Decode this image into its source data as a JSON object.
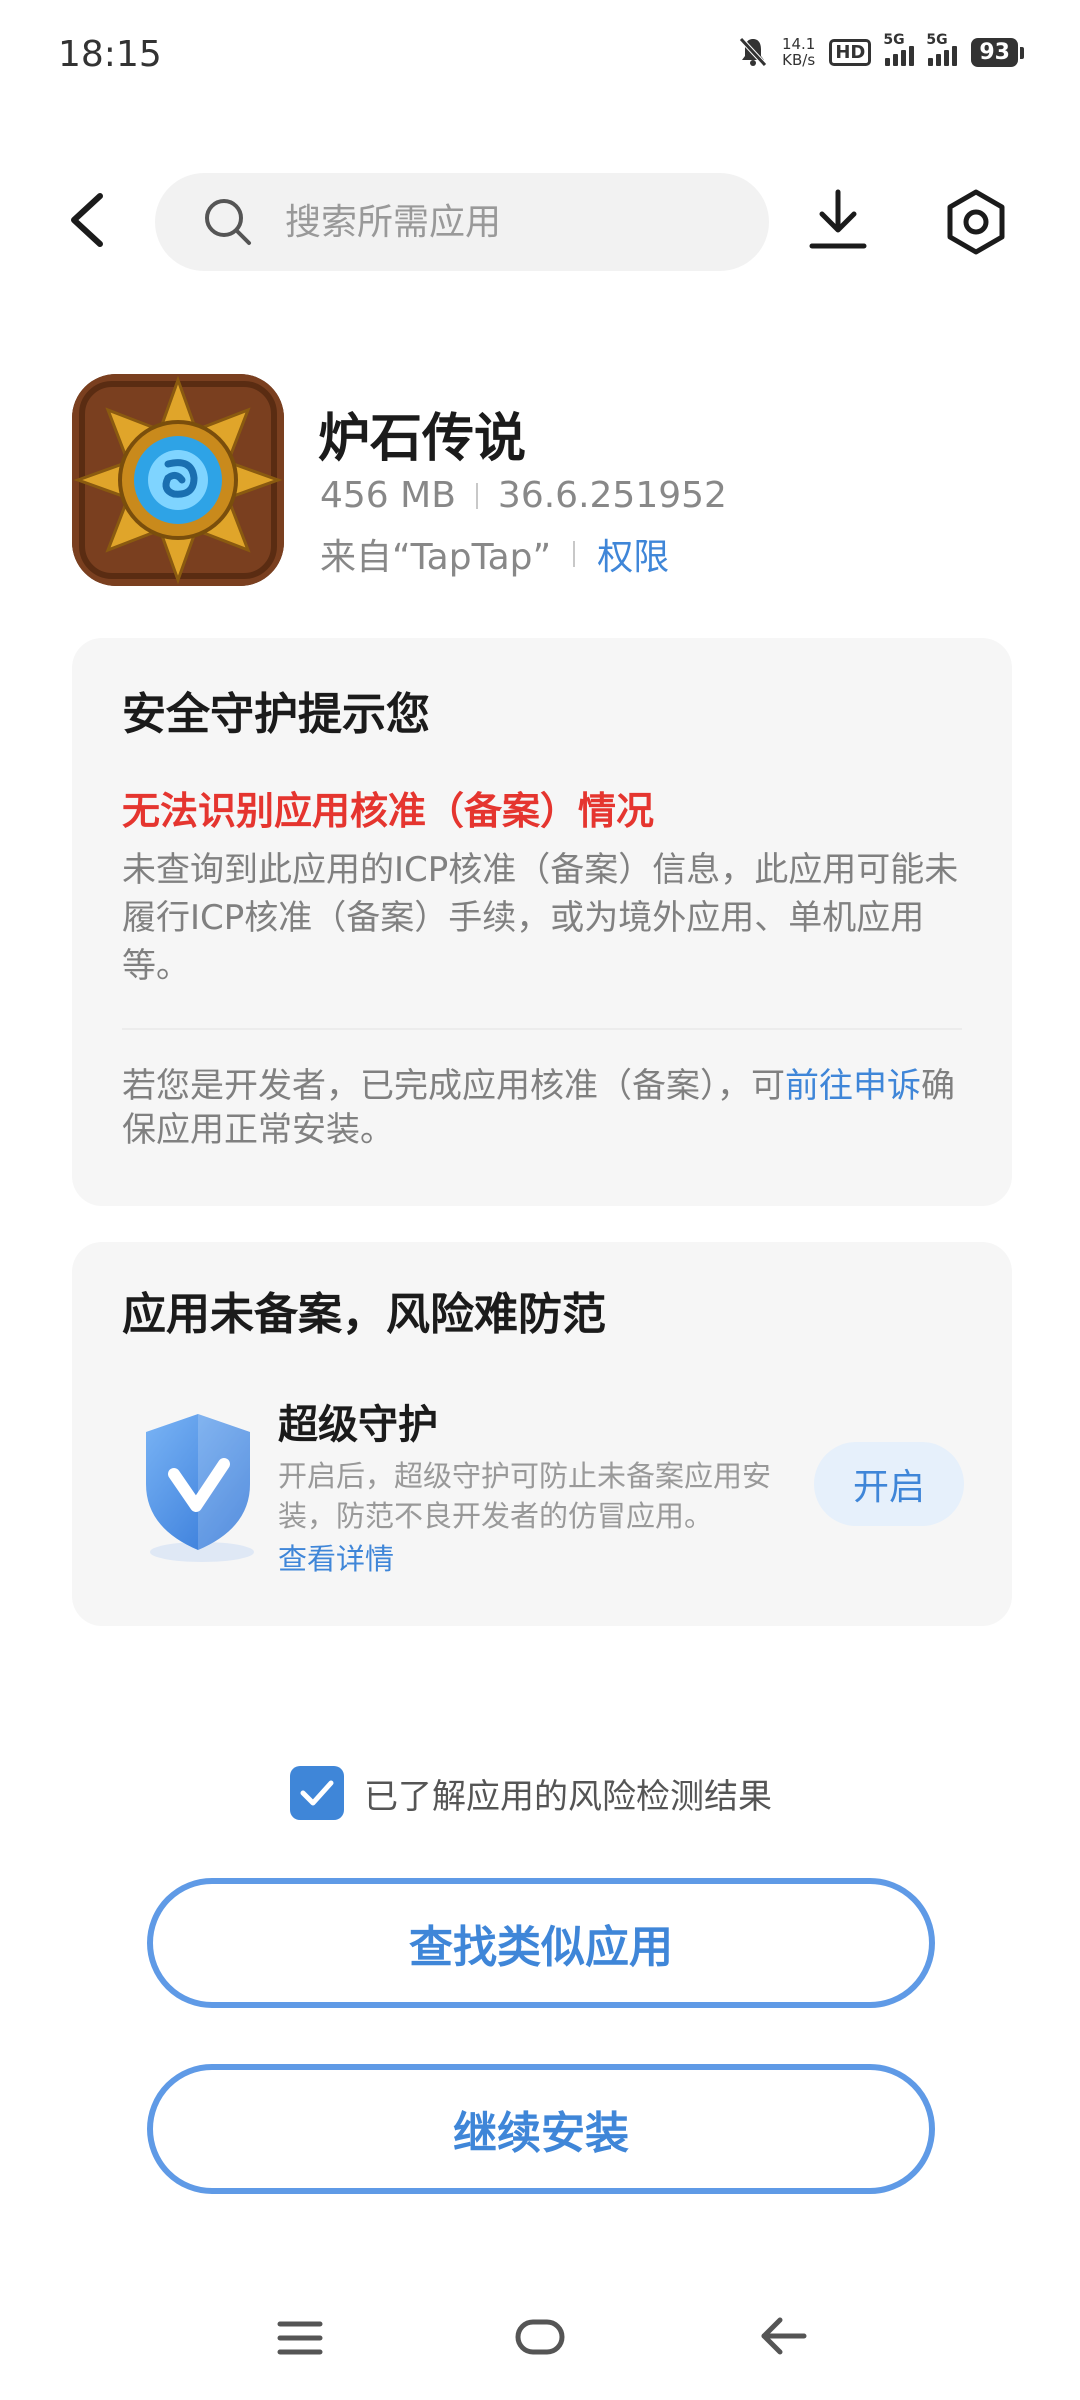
{
  "status_bar": {
    "time": "18:15",
    "net_speed_value": "14.1",
    "net_speed_unit": "KB/s",
    "hd_label": "HD",
    "signal1_label": "5G",
    "signal2_label": "5G",
    "battery": "93"
  },
  "search": {
    "placeholder": "搜索所需应用"
  },
  "app": {
    "name": "炉石传说",
    "size": "456 MB",
    "version": "36.6.251952",
    "source": "来自“TapTap”",
    "permissions_link": "权限"
  },
  "security_card": {
    "title": "安全守护提示您",
    "warning": "无法识别应用核准（备案）情况",
    "description": "未查询到此应用的ICP核准（备案）信息，此应用可能未履行ICP核准（备案）手续，或为境外应用、单机应用等。",
    "note_prefix": "若您是开发者，已完成应用核准（备案），可",
    "note_link": "前往申诉",
    "note_suffix": "确保应用正常安装。"
  },
  "risk_card": {
    "title": "应用未备案，风险难防范",
    "guard_title": "超级守护",
    "guard_desc": "开启后，超级守护可防止未备案应用安装，防范不良开发者的仿冒应用。",
    "guard_link": "查看详情",
    "enable_button": "开启"
  },
  "acknowledge": {
    "label": "已了解应用的风险检测结果",
    "checked": true
  },
  "buttons": {
    "find_similar": "查找类似应用",
    "continue_install": "继续安装"
  },
  "colors": {
    "accent": "#3f86d8",
    "warning": "#e5352f",
    "card_bg": "#f6f6f6"
  },
  "icons": {
    "back": "chevron-left-icon",
    "search": "search-icon",
    "download": "download-icon",
    "settings": "gear-icon"
  }
}
